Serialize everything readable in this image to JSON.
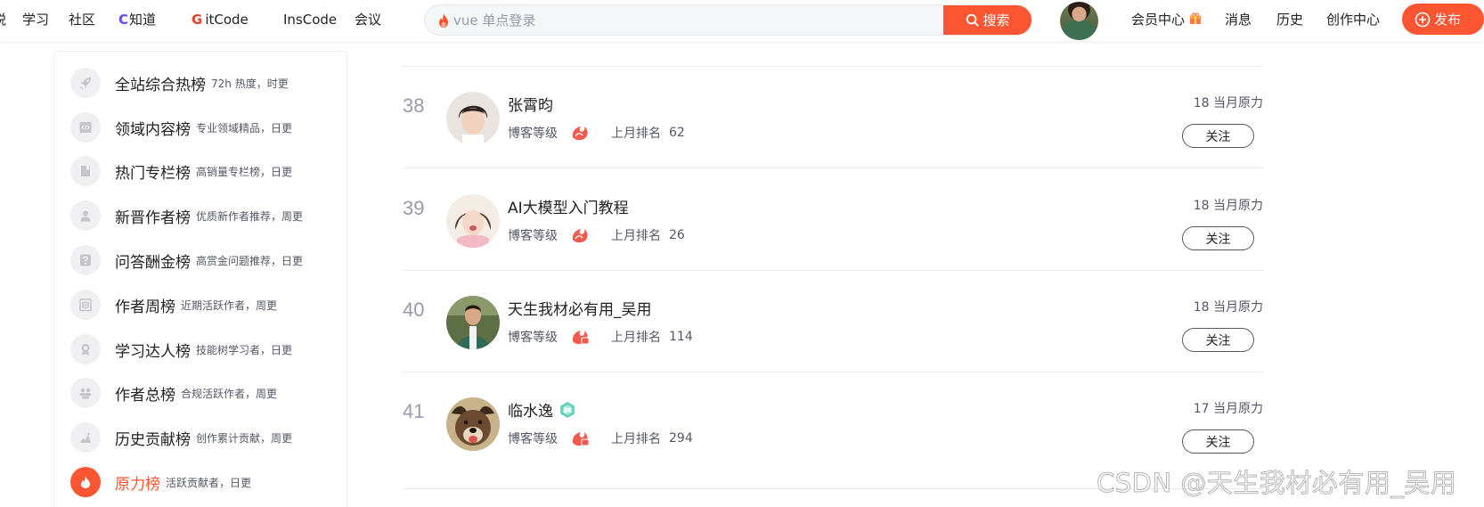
{
  "nav": {
    "items": [
      "悦",
      "学习",
      "社区",
      "C知道",
      "GitCode",
      "InsCode",
      "会议"
    ],
    "cknow_brand": "C",
    "cknow_rest": "知道",
    "gitcode_brand": "G",
    "gitcode_rest": "itCode"
  },
  "search": {
    "placeholder": "vue 单点登录",
    "button_label": "搜索"
  },
  "header_links": {
    "vip": "会员中心",
    "messages": "消息",
    "history": "历史",
    "creator_center": "创作中心",
    "publish": "发布"
  },
  "sidebar": {
    "items": [
      {
        "name": "全站综合热榜",
        "desc": "72h 热度，时更",
        "icon": "rocket-icon"
      },
      {
        "name": "领域内容榜",
        "desc": "专业领域精品，日更",
        "icon": "code-icon"
      },
      {
        "name": "热门专栏榜",
        "desc": "高销量专栏榜，日更",
        "icon": "book-icon"
      },
      {
        "name": "新晋作者榜",
        "desc": "优质新作者推荐，周更",
        "icon": "user-icon"
      },
      {
        "name": "问答酬金榜",
        "desc": "高赏金问题推荐，日更",
        "icon": "question-icon"
      },
      {
        "name": "作者周榜",
        "desc": "近期活跃作者，周更",
        "icon": "calendar-icon"
      },
      {
        "name": "学习达人榜",
        "desc": "技能树学习者，日更",
        "icon": "medal-icon"
      },
      {
        "name": "作者总榜",
        "desc": "合规活跃作者，周更",
        "icon": "group-icon"
      },
      {
        "name": "历史贡献榜",
        "desc": "创作累计贡献，周更",
        "icon": "podium-icon"
      },
      {
        "name": "原力榜",
        "desc": "活跃贡献者，日更",
        "icon": "fire-icon"
      }
    ]
  },
  "ranking": {
    "level_label": "博客等级",
    "last_month_label": "上月排名",
    "follow_label": "关注",
    "rows": [
      {
        "rank": "38",
        "name": "张霄昀",
        "power": "18 当月原力",
        "last_rank": "62"
      },
      {
        "rank": "39",
        "name": "AI大模型入门教程",
        "power": "18 当月原力",
        "last_rank": "26"
      },
      {
        "rank": "40",
        "name": "天生我材必有用_吴用",
        "power": "18 当月原力",
        "last_rank": "114"
      },
      {
        "rank": "41",
        "name": "临水逸",
        "power": "17 当月原力",
        "last_rank": "294"
      }
    ]
  },
  "watermark": "CSDN @天生我材必有用_吴用",
  "colors": {
    "brand_orange": "#fc5531",
    "text_primary": "#222226",
    "text_secondary": "#555666",
    "rank_gray": "#999aaa"
  }
}
